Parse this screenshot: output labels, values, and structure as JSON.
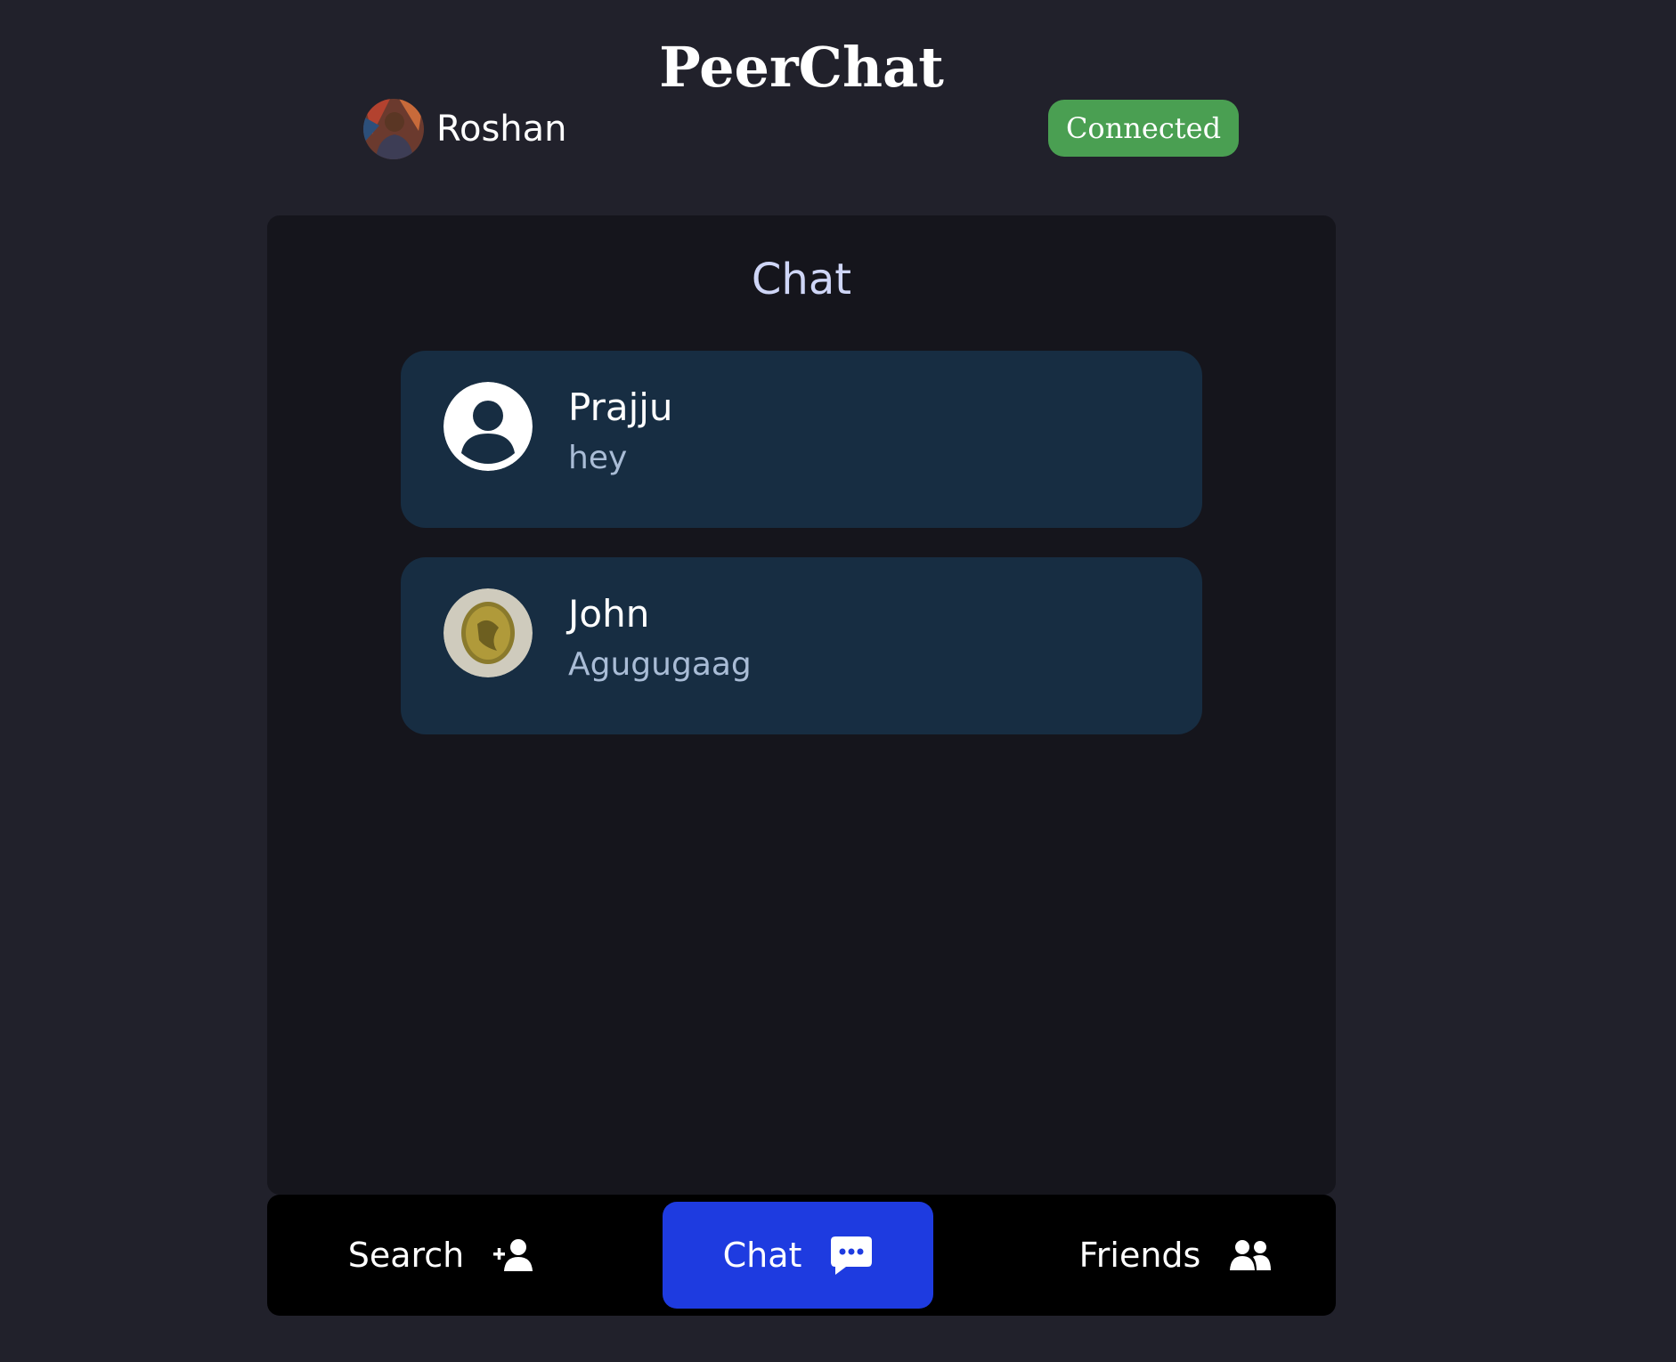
{
  "app": {
    "title": "PeerChat"
  },
  "user": {
    "name": "Roshan",
    "avatar_icon": "user-photo-avatar"
  },
  "status": {
    "label": "Connected",
    "color": "#4a9f52"
  },
  "panel": {
    "title": "Chat"
  },
  "chats": [
    {
      "name": "Prajju",
      "last_message": "hey",
      "avatar_icon": "default-user-icon"
    },
    {
      "name": "John",
      "last_message": "Agugugaag",
      "avatar_icon": "coin-photo-avatar"
    }
  ],
  "nav": {
    "search": {
      "label": "Search",
      "icon": "add-user-icon"
    },
    "chat": {
      "label": "Chat",
      "icon": "chat-bubble-icon",
      "active": true
    },
    "friends": {
      "label": "Friends",
      "icon": "friends-icon"
    }
  },
  "colors": {
    "background": "#21212b",
    "panel": "#15151c",
    "chat_card": "#172d42",
    "nav_active": "#1e3be0"
  }
}
